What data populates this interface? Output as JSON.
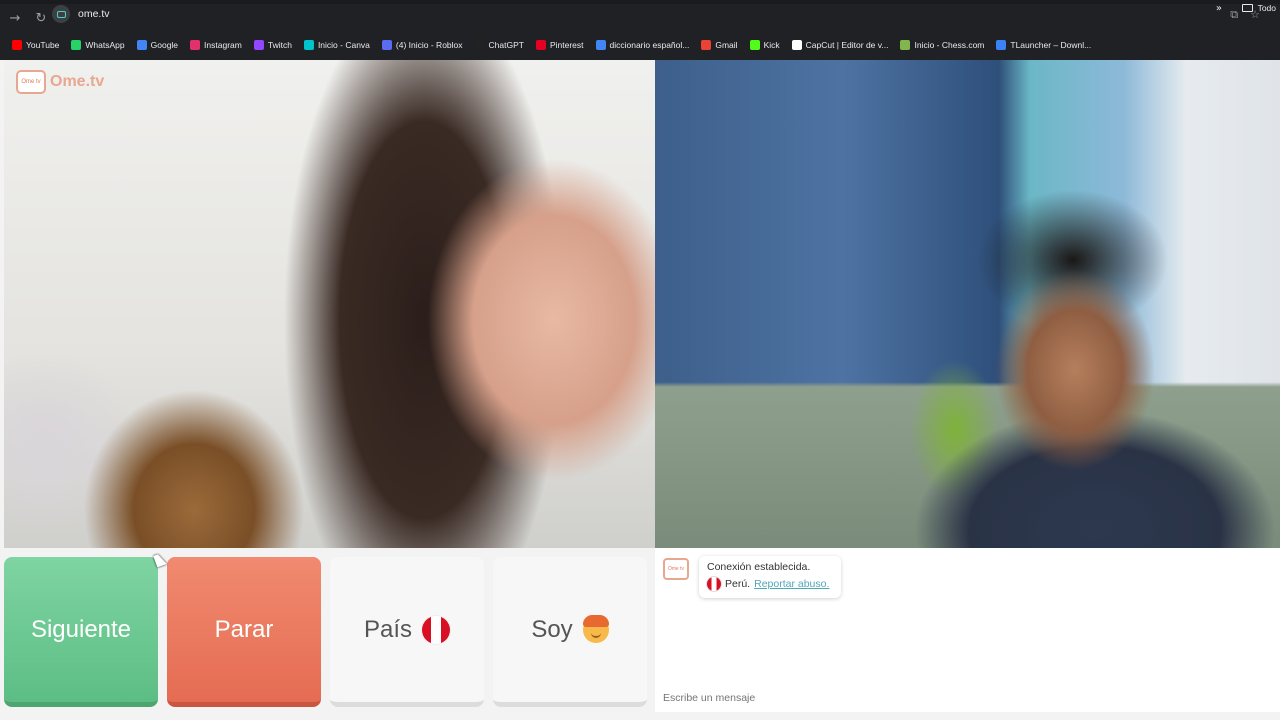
{
  "browser": {
    "url": "ome.tv",
    "back_icon": "arrow-right-icon",
    "reload_icon": "reload-icon",
    "bookmarks": [
      {
        "label": "YouTube",
        "color": "#ff0000"
      },
      {
        "label": "WhatsApp",
        "color": "#25d366"
      },
      {
        "label": "Google",
        "color": "#4285f4"
      },
      {
        "label": "Instagram",
        "color": "#e1306c"
      },
      {
        "label": "Twitch",
        "color": "#9146ff"
      },
      {
        "label": "Inicio - Canva",
        "color": "#00c4cc"
      },
      {
        "label": "(4) Inicio - Roblox",
        "color": "#5a6cf0"
      },
      {
        "label": "ChatGPT",
        "color": "#222222"
      },
      {
        "label": "Pinterest",
        "color": "#e60023"
      },
      {
        "label": "diccionario español...",
        "color": "#4285f4"
      },
      {
        "label": "Gmail",
        "color": "#ea4335"
      },
      {
        "label": "Kick",
        "color": "#53fc18"
      },
      {
        "label": "CapCut | Editor de v...",
        "color": "#ffffff"
      },
      {
        "label": "Inicio - Chess.com",
        "color": "#81b64c"
      },
      {
        "label": "TLauncher – Downl...",
        "color": "#3b82f6"
      }
    ],
    "more_bookmarks": "»",
    "folder_label": "Todo"
  },
  "app": {
    "logo_text": "Ome.tv",
    "logo_badge": "Ome tv"
  },
  "controls": {
    "next_label": "Siguiente",
    "stop_label": "Parar",
    "country_label": "País",
    "me_label": "Soy"
  },
  "chat": {
    "status": "Conexión establecida.",
    "country": "Perú.",
    "report_link": "Reportar abuso.",
    "placeholder": "Escribe un mensaje"
  }
}
